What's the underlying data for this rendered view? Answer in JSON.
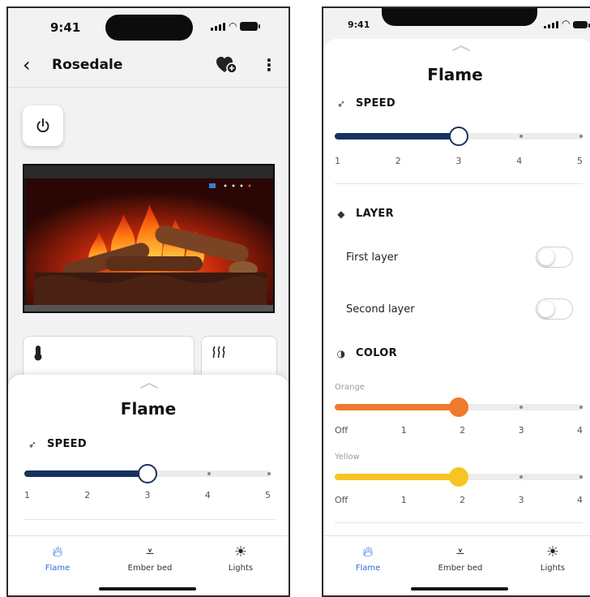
{
  "colors": {
    "accent": "#2e6bd8",
    "speed_fill": "#17325f",
    "orange": "#ef7a2e",
    "yellow": "#f5c521",
    "track": "#ececec"
  },
  "status_bar": {
    "time": "9:41"
  },
  "left": {
    "header": {
      "title": "Rosedale",
      "back_icon": "chevron-left-icon",
      "fav_icon": "heart-plus-icon",
      "more_icon": "more-vertical-icon"
    },
    "power_icon": "power-icon",
    "cards": [
      {
        "icon": "thermometer-icon"
      },
      {
        "icon": "heat-waves-icon"
      }
    ],
    "sheet": {
      "title": "Flame",
      "speed": {
        "label": "SPEED",
        "value": 3,
        "ticks": [
          "1",
          "2",
          "3",
          "4",
          "5"
        ]
      }
    }
  },
  "right": {
    "sheet": {
      "title": "Flame",
      "speed": {
        "label": "SPEED",
        "value": 3,
        "ticks": [
          "1",
          "2",
          "3",
          "4",
          "5"
        ]
      },
      "layer": {
        "label": "LAYER",
        "rows": [
          {
            "label": "First layer",
            "on": false
          },
          {
            "label": "Second layer",
            "on": false
          }
        ]
      },
      "color": {
        "label": "COLOR",
        "channels": [
          {
            "name": "Orange",
            "value": 2,
            "ticks": [
              "Off",
              "1",
              "2",
              "3",
              "4"
            ]
          },
          {
            "name": "Yellow",
            "value": 2,
            "ticks": [
              "Off",
              "1",
              "2",
              "3",
              "4"
            ]
          }
        ]
      }
    }
  },
  "tabs": [
    {
      "label": "Flame",
      "icon": "flame-icon",
      "active": true
    },
    {
      "label": "Ember bed",
      "icon": "ember-bed-icon",
      "active": false
    },
    {
      "label": "Lights",
      "icon": "sun-icon",
      "active": false
    }
  ]
}
